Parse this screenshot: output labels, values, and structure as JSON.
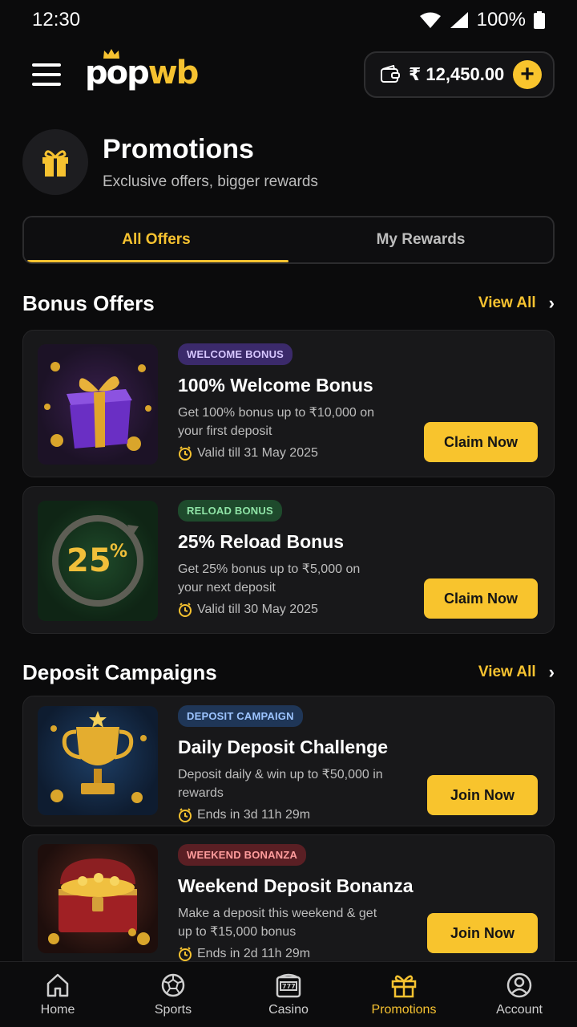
{
  "status_bar": {
    "time": "12:30",
    "battery": "100%"
  },
  "header": {
    "logo_pop": "pop",
    "logo_wb": "wb",
    "wallet_amount": "₹ 12,450.00",
    "add_label": "+"
  },
  "page": {
    "title": "Promotions",
    "subtitle": "Exclusive offers, bigger rewards"
  },
  "tabs": [
    {
      "label": "All Offers",
      "active": true
    },
    {
      "label": "My Rewards",
      "active": false
    }
  ],
  "bonus_section": {
    "title": "Bonus Offers",
    "view_all": "View All",
    "cards": [
      {
        "badge": "WELCOME BONUS",
        "title": "100% Welcome Bonus",
        "description": "Get 100% bonus up to ₹10,000 on your first deposit",
        "meta": "Valid till 31 May 2025",
        "cta": "Claim Now",
        "image": "purple-gift-box"
      },
      {
        "badge": "RELOAD BONUS",
        "title": "25% Reload Bonus",
        "description": "Get 25% bonus up to ₹5,000 on your next deposit",
        "meta": "Valid till 30 May 2025",
        "cta": "Claim Now",
        "image": "reload-25-percent",
        "image_text": "25",
        "image_text_sup": "%"
      }
    ]
  },
  "deposit_section": {
    "title": "Deposit Campaigns",
    "view_all": "View All",
    "cards": [
      {
        "badge": "DEPOSIT CAMPAIGN",
        "title": "Daily Deposit Challenge",
        "description": "Deposit daily & win up to ₹50,000 in rewards",
        "meta": "Ends in 3d 11h 29m",
        "cta": "Join Now",
        "image": "gold-trophy"
      },
      {
        "badge": "WEEKEND BONANZA",
        "title": "Weekend Deposit Bonanza",
        "description": "Make a deposit this weekend & get up to ₹15,000 bonus",
        "meta": "Ends in 2d 11h 29m",
        "cta": "Join Now",
        "image": "treasure-chest"
      }
    ]
  },
  "bottom_nav": [
    {
      "label": "Home",
      "icon": "home-icon",
      "active": false
    },
    {
      "label": "Sports",
      "icon": "football-icon",
      "active": false
    },
    {
      "label": "Casino",
      "icon": "slot-machine-icon",
      "active": false
    },
    {
      "label": "Promotions",
      "icon": "gift-icon",
      "active": true
    },
    {
      "label": "Account",
      "icon": "user-icon",
      "active": false
    }
  ],
  "colors": {
    "accent": "#f6c230",
    "background": "#0b0b0c",
    "card": "#18181a"
  }
}
